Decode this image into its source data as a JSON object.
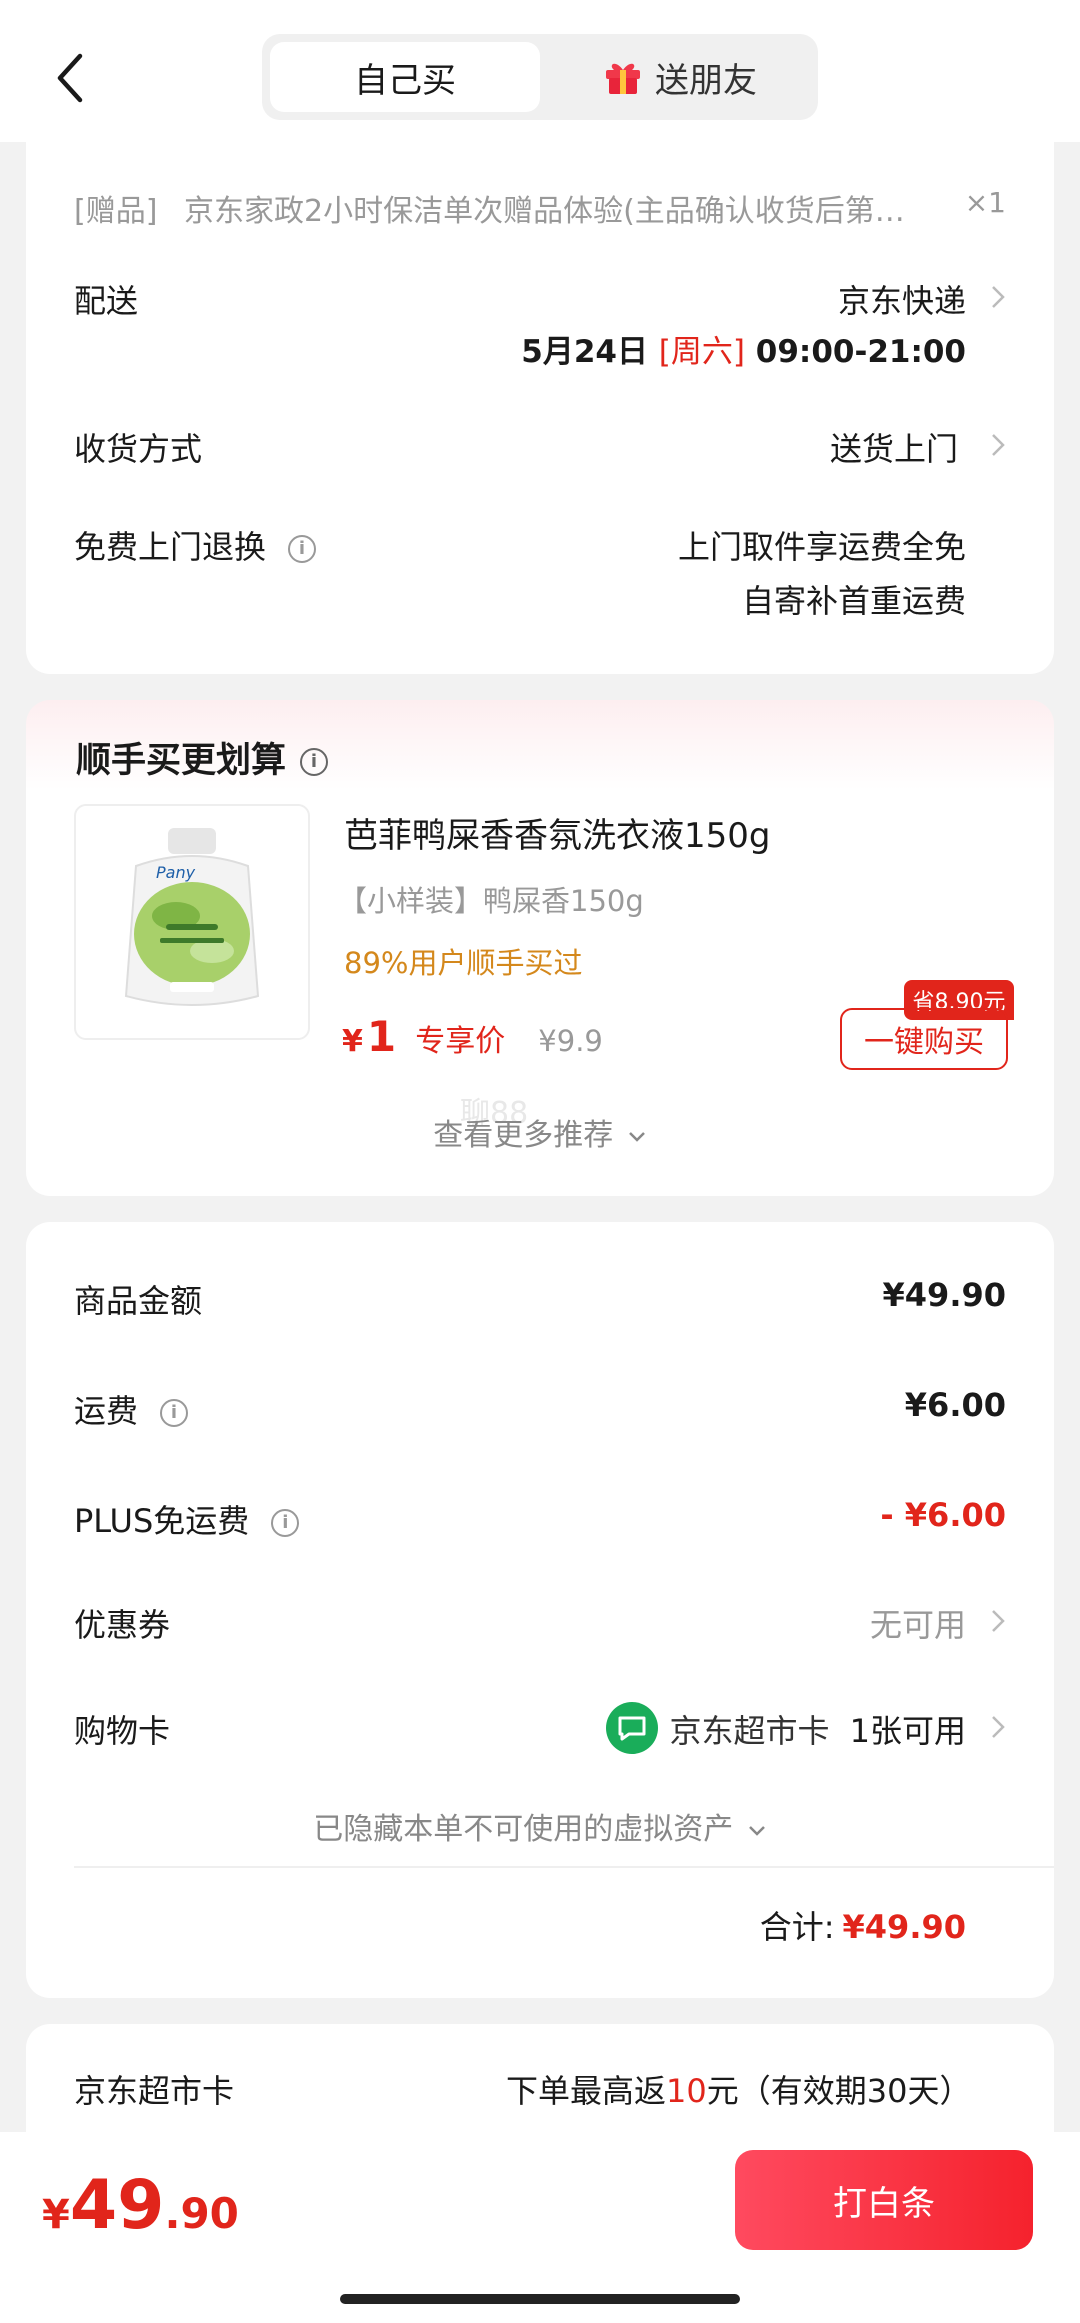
{
  "header": {
    "tab_self": "自己买",
    "tab_gift": "送朋友"
  },
  "gift_item": {
    "tag": "[赠品]",
    "name": "京东家政2小时保洁单次赠品体验(主品确认收货后第…",
    "qty": "×1"
  },
  "delivery": {
    "label": "配送",
    "carrier": "京东快递",
    "date": "5月24日",
    "weekday": "[周六]",
    "time": "09:00-21:00",
    "receive_label": "收货方式",
    "receive_value": "送货上门",
    "return_label": "免费上门退换",
    "return_line1": "上门取件享运费全免",
    "return_line2": "自寄补首重运费"
  },
  "addon": {
    "title": "顺手买更划算",
    "product_name": "芭菲鸭屎香香氛洗衣液150g",
    "spec": "【小样装】鸭屎香150g",
    "social": "89%用户顺手买过",
    "price_symbol": "¥",
    "price": "1",
    "price_tag": "专享价",
    "orig_price": "¥9.9",
    "save_badge": "省8.90元",
    "buy_button": "一键购买",
    "more": "查看更多推荐",
    "watermark": "聊88"
  },
  "summary": {
    "goods_label": "商品金额",
    "goods_value": "¥49.90",
    "ship_label": "运费",
    "ship_value": "¥6.00",
    "plus_label": "PLUS免运费",
    "plus_value": "- ¥6.00",
    "coupon_label": "优惠券",
    "coupon_value": "无可用",
    "card_label": "购物卡",
    "card_name": "京东超市卡",
    "card_avail": "1张可用",
    "hidden_note": "已隐藏本单不可使用的虚拟资产",
    "total_label": "合计:",
    "total_value": "¥49.90"
  },
  "supercard": {
    "label": "京东超市卡",
    "text_pre": "下单最高返",
    "text_num": "10",
    "text_post": "元（有效期30天）"
  },
  "footer": {
    "currency": "¥",
    "amount_int": "49",
    "amount_dec": ".90",
    "pay_button": "打白条"
  },
  "colors": {
    "red": "#e1251b",
    "orange": "#d4881c",
    "green": "#1aad5a"
  }
}
